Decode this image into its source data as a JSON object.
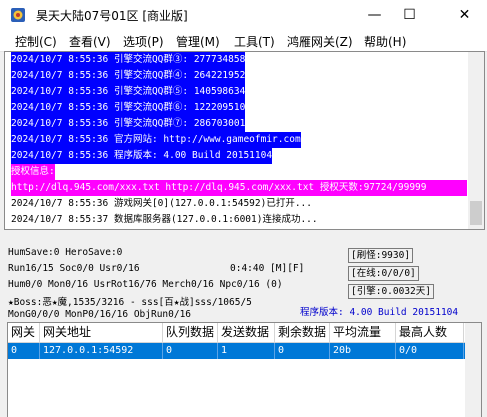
{
  "window": {
    "title": "昊天大陆07号01区 [商业版]",
    "minimize_glyph": "—",
    "maximize_glyph": "☐",
    "close_glyph": "✕"
  },
  "menu": [
    "控制(C)",
    "查看(V)",
    "选项(P)",
    "管理(M)",
    "工具(T)",
    "鸿雁网关(Z)",
    "帮助(H)"
  ],
  "log": {
    "lines": [
      "2024/10/7 8:55:36 引擎交流QQ群③: 277734858",
      "2024/10/7 8:55:36 引擎交流QQ群④: 264221952",
      "2024/10/7 8:55:36 引擎交流QQ群⑤: 140598634",
      "2024/10/7 8:55:36 引擎交流QQ群⑥: 122209510",
      "2024/10/7 8:55:36 引擎交流QQ群⑦: 286703001",
      "2024/10/7 8:55:36 官方网站: http://www.gameofmir.com",
      "2024/10/7 8:55:36 程序版本: 4.00 Build 20151104",
      "授权信息:",
      "http://dlq.945.com/xxx.txt http://dlq.945.com/xxx.txt 授权天数:97724/99999",
      "2024/10/7 8:55:36 游戏网关[0](127.0.0.1:54592)已打开...",
      "2024/10/7 8:55:37 数据库服务器(127.0.0.1:6001)连接成功..."
    ]
  },
  "status": {
    "line1": "HumSave:0 HeroSave:0",
    "line2": "Run16/15 Soc0/0 Usr0/16",
    "timer": "0:4:40 [M][F]",
    "line3": "Hum0/0 Mon0/16 UsrRot16/76 Merch0/16 Npc0/16 (0)",
    "line4": "★Boss:恶★魔,1535/3216 - sss[百★战]sss/1065/5",
    "line5": "MonG0/0/0 MonP0/16/16 ObjRun0/16",
    "refresh": "[刷怪:9930]",
    "online": "[在线:0/0/0]",
    "engine": "[引擎:0.0032天]",
    "version": "程序版本: 4.00 Build 20151104"
  },
  "table": {
    "headers": [
      "网关",
      "网关地址",
      "队列数据",
      "发送数据",
      "剩余数据",
      "平均流量",
      "最高人数"
    ],
    "rows": [
      [
        "0",
        "127.0.0.1:54592",
        "0",
        "1",
        "0",
        "20b",
        "0/0"
      ]
    ]
  },
  "colors": {
    "selection": "#0000ff",
    "highlight": "#ff00ff",
    "row_selected": "#0078d7",
    "version_text": "#0000cc"
  }
}
